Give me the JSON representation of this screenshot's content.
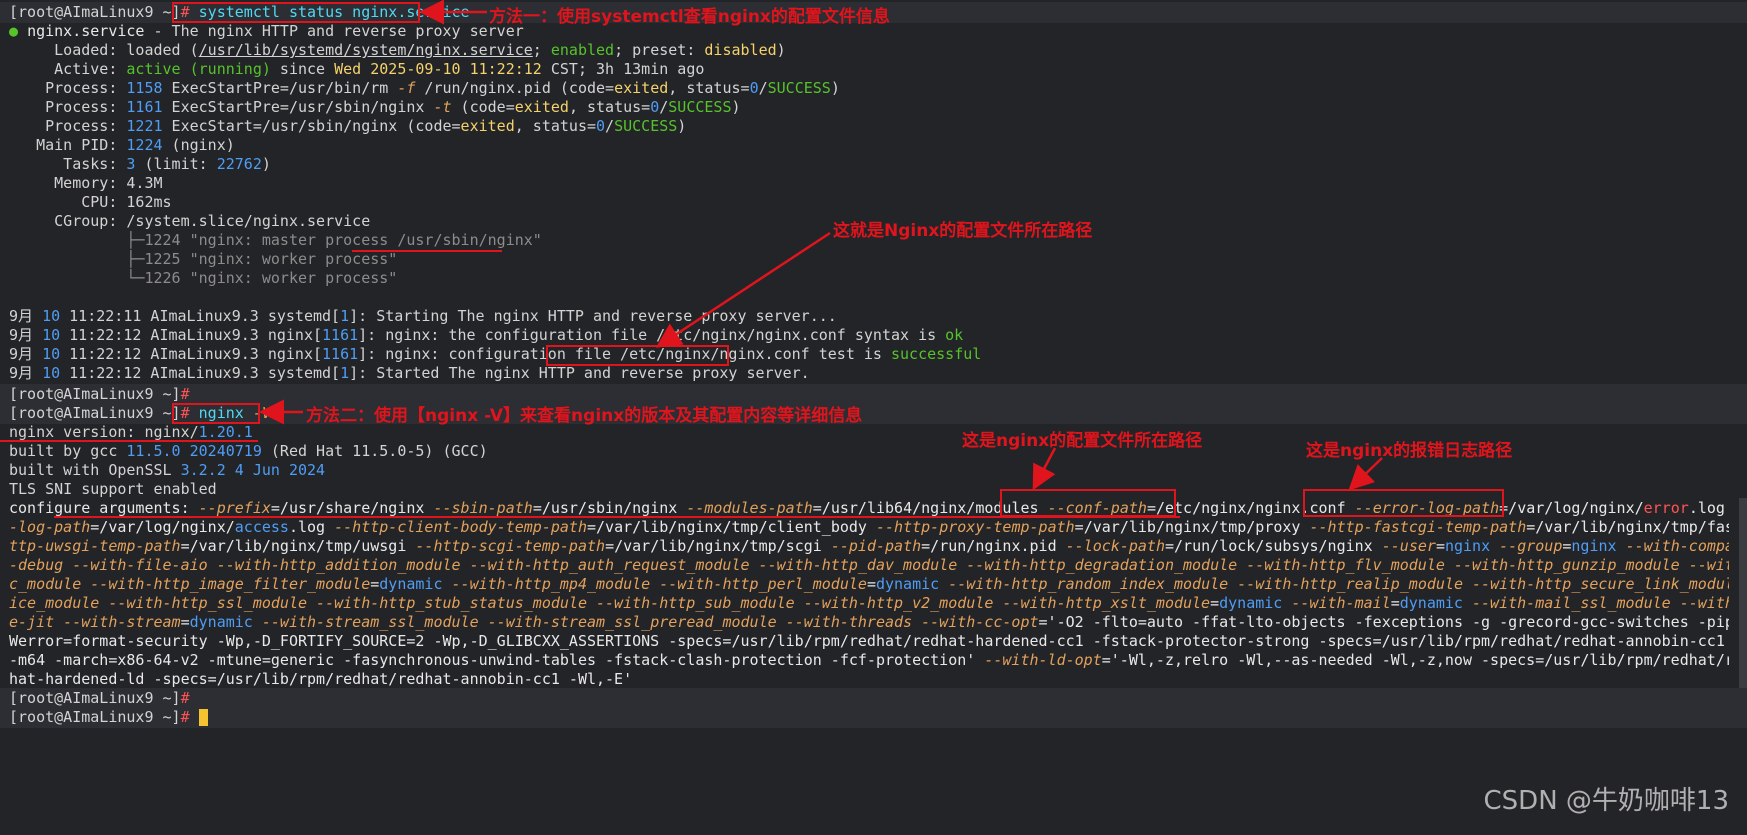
{
  "prompt": "[root@AImaLinux9 ~]",
  "cmd1": "systemctl status nginx.service",
  "status": {
    "line1_unit": "nginx.service",
    "line1_desc": " - The nginx HTTP and reverse proxy server",
    "loaded_label": "     Loaded: ",
    "loaded_text": "loaded (",
    "loaded_path": "/usr/lib/systemd/system/nginx.service",
    "loaded_rest_a": "; ",
    "loaded_enabled": "enabled",
    "loaded_rest_b": "; preset: ",
    "loaded_preset": "disabled",
    "loaded_close": ")",
    "active_label": "     Active: ",
    "active_val": "active (running)",
    "active_since": " since ",
    "active_date": "Wed 2025-09-10 11:22:12",
    "active_rest": " CST; 3h 13min ago",
    "proc1_label": "    Process: ",
    "proc1_pid": "1158",
    "proc1_cmd_a": " ExecStartPre=/usr/bin/rm ",
    "proc1_flag": "-f",
    "proc1_cmd_b": " /run/nginx.pid (code=",
    "proc1_code": "exited",
    "proc1_status": ", status=",
    "proc1_zero": "0",
    "proc1_slash": "/",
    "proc1_success": "SUCCESS",
    "proc1_close": ")",
    "proc2_label": "    Process: ",
    "proc2_pid": "1161",
    "proc2_cmd_a": " ExecStartPre=/usr/sbin/nginx ",
    "proc2_flag": "-t",
    "proc2_cmd_b": " (code=",
    "proc2_code": "exited",
    "proc2_status": ", status=",
    "proc2_zero": "0",
    "proc2_slash": "/",
    "proc2_success": "SUCCESS",
    "proc2_close": ")",
    "proc3_label": "    Process: ",
    "proc3_pid": "1221",
    "proc3_cmd_a": " ExecStart=/usr/sbin/nginx (code=",
    "proc3_code": "exited",
    "proc3_status": ", status=",
    "proc3_zero": "0",
    "proc3_slash": "/",
    "proc3_success": "SUCCESS",
    "proc3_close": ")",
    "mainpid_label": "   Main PID: ",
    "mainpid_val": "1224",
    "mainpid_rest": " (nginx)",
    "tasks_label": "      Tasks: ",
    "tasks_val": "3",
    "tasks_rest_a": " (limit: ",
    "tasks_limit": "22762",
    "tasks_close": ")",
    "memory_label": "     Memory: ",
    "memory_val": "4.3M",
    "cpu_label": "        CPU: ",
    "cpu_val": "162ms",
    "cgroup_label": "     CGroup: ",
    "cgroup_val": "/system.slice/nginx.service",
    "cg1": "             ├─1224 \"nginx: master process /usr/sbin/nginx\"",
    "cg2": "             ├─1225 \"nginx: worker process\"",
    "cg3": "             └─1226 \"nginx: worker process\""
  },
  "journal": {
    "j1_mon": "9月 ",
    "j1_day": "10",
    "j1_rest_a": " 11:22:11 AImaLinux9.3 systemd[",
    "j1_pid": "1",
    "j1_rest_b": "]: Starting The nginx HTTP and reverse proxy server...",
    "j2_mon": "9月 ",
    "j2_day": "10",
    "j2_rest_a": " 11:22:12 AImaLinux9.3 nginx[",
    "j2_pid": "1161",
    "j2_rest_b": "]: nginx: the configuration file /etc/nginx/nginx.conf syntax is ",
    "j2_ok": "ok",
    "j3_mon": "9月 ",
    "j3_day": "10",
    "j3_rest_a": " 11:22:12 AImaLinux9.3 nginx[",
    "j3_pid": "1161",
    "j3_rest_b": "]: nginx: configuration file /etc/nginx/nginx.conf test is ",
    "j3_ok": "successful",
    "j4_mon": "9月 ",
    "j4_day": "10",
    "j4_rest_a": " 11:22:12 AImaLinux9.3 systemd[",
    "j4_pid": "1",
    "j4_rest_b": "]: Started The nginx HTTP and reverse proxy server."
  },
  "cmd2_a": "nginx ",
  "cmd2_b": "-V",
  "nginxv": {
    "ver_label": "nginx version: nginx/",
    "ver_val": "1.20.1",
    "built_a": "built by gcc ",
    "built_b": "11.5.0 20240719",
    "built_c": " (Red Hat 11.5.0-5) (GCC)",
    "ssl_a": "built with OpenSSL ",
    "ssl_b": "3.2.2 4 Jun 2024",
    "tls": "TLS SNI support enabled"
  },
  "configure": {
    "c1": [
      [
        "wh",
        "configure arguments: "
      ],
      [
        "or",
        "--prefix"
      ],
      [
        "wh",
        "=/usr/share/nginx "
      ],
      [
        "or",
        "--sbin-path"
      ],
      [
        "wh",
        "=/usr/sbin/nginx "
      ],
      [
        "or",
        "--modules-path"
      ],
      [
        "wh",
        "=/usr/lib64/nginx/modules "
      ],
      [
        "or",
        "--conf-path"
      ],
      [
        "wh",
        "=/etc/nginx/nginx.conf "
      ],
      [
        "or",
        "--error-log-path"
      ],
      [
        "wh",
        "=/var/log/nginx/"
      ],
      [
        "rd",
        "error"
      ],
      [
        "wh",
        ".log "
      ],
      [
        "or",
        "--http"
      ]
    ],
    "c2": [
      [
        "or",
        "-log-path"
      ],
      [
        "wh",
        "=/var/log/nginx/"
      ],
      [
        "bl",
        "access"
      ],
      [
        "wh",
        ".log "
      ],
      [
        "or",
        "--http-client-body-temp-path"
      ],
      [
        "wh",
        "=/var/lib/nginx/tmp/client_body "
      ],
      [
        "or",
        "--http-proxy-temp-path"
      ],
      [
        "wh",
        "=/var/lib/nginx/tmp/proxy "
      ],
      [
        "or",
        "--http-fastcgi-temp-path"
      ],
      [
        "wh",
        "=/var/lib/nginx/tmp/fastcgi "
      ],
      [
        "or",
        "--h"
      ]
    ],
    "c3": [
      [
        "or",
        "ttp-uwsgi-temp-path"
      ],
      [
        "wh",
        "=/var/lib/nginx/tmp/uwsgi "
      ],
      [
        "or",
        "--http-scgi-temp-path"
      ],
      [
        "wh",
        "=/var/lib/nginx/tmp/scgi "
      ],
      [
        "or",
        "--pid-path"
      ],
      [
        "wh",
        "=/run/nginx.pid "
      ],
      [
        "or",
        "--lock-path"
      ],
      [
        "wh",
        "=/run/lock/subsys/nginx "
      ],
      [
        "or",
        "--user"
      ],
      [
        "wh",
        "="
      ],
      [
        "bl",
        "nginx"
      ],
      [
        "wh",
        " "
      ],
      [
        "or",
        "--group"
      ],
      [
        "wh",
        "="
      ],
      [
        "bl",
        "nginx"
      ],
      [
        "wh",
        " "
      ],
      [
        "or",
        "--with-compat --with"
      ]
    ],
    "c4": [
      [
        "or",
        "-debug --with-file-aio --with-http_addition_module --with-http_auth_request_module --with-http_dav_module --with-http_degradation_module --with-http_flv_module --with-http_gunzip_module --with-http_gzip_stati"
      ]
    ],
    "c5": [
      [
        "or",
        "c_module --with-http_image_filter_module"
      ],
      [
        "wh",
        "="
      ],
      [
        "bl",
        "dynamic"
      ],
      [
        "wh",
        " "
      ],
      [
        "or",
        "--with-http_mp4_module --with-http_perl_module"
      ],
      [
        "wh",
        "="
      ],
      [
        "bl",
        "dynamic"
      ],
      [
        "wh",
        " "
      ],
      [
        "or",
        "--with-http_random_index_module --with-http_realip_module --with-http_secure_link_module --with-http_sl"
      ]
    ],
    "c6": [
      [
        "or",
        "ice_module --with-http_ssl_module --with-http_stub_status_module --with-http_sub_module --with-http_v2_module --with-http_xslt_module"
      ],
      [
        "wh",
        "="
      ],
      [
        "bl",
        "dynamic"
      ],
      [
        "wh",
        " "
      ],
      [
        "or",
        "--with-mail"
      ],
      [
        "wh",
        "="
      ],
      [
        "bl",
        "dynamic"
      ],
      [
        "wh",
        " "
      ],
      [
        "or",
        "--with-mail_ssl_module --with-pcre --with-pcr"
      ]
    ],
    "c7": [
      [
        "or",
        "e-jit --with-stream"
      ],
      [
        "wh",
        "="
      ],
      [
        "bl",
        "dynamic"
      ],
      [
        "wh",
        " "
      ],
      [
        "or",
        "--with-stream_ssl_module --with-stream_ssl_preread_module --with-threads --with-cc-opt"
      ],
      [
        "wh",
        "='-O2 -flto=auto -ffat-lto-objects -fexceptions -g -grecord-gcc-switches -pipe -Wall -"
      ]
    ],
    "c8": [
      [
        "wh",
        "Werror=format-security -Wp,-D_FORTIFY_SOURCE=2 -Wp,-D_GLIBCXX_ASSERTIONS -specs=/usr/lib/rpm/redhat/redhat-hardened-cc1 -fstack-protector-strong -specs=/usr/lib/rpm/redhat/redhat-annobin-cc1 "
      ]
    ],
    "c9": [
      [
        "wh",
        "-m64 -march=x86-64-v2 -mtune=generic -fasynchronous-unwind-tables -fstack-clash-protection -fcf-protection' "
      ],
      [
        "or",
        "--with-ld-opt"
      ],
      [
        "wh",
        "='-Wl,-z,relro -Wl,--as-needed -Wl,-z,now -specs=/usr/lib/rpm/redhat/red"
      ]
    ],
    "c10": [
      [
        "wh",
        "hat-hardened-ld -specs=/usr/lib/rpm/redhat/redhat-annobin-cc1 -Wl,-E'"
      ]
    ]
  },
  "annotations": {
    "a1": "方法一：使用systemctl查看nginx的配置文件信息",
    "a2": "这就是Nginx的配置文件所在路径",
    "a3": "方法二：使用【nginx -V】来查看nginx的版本及其配置内容等详细信息",
    "a4": "这是nginx的配置文件所在路径",
    "a5": "这是nginx的报错日志路径"
  },
  "watermark": "CSDN @牛奶咖啡13",
  "colors": {
    "background": "#232427",
    "annotation_red": "#e0141c",
    "green": "#56c32b",
    "blue": "#4f9df5",
    "orange_flag": "#e2a15c",
    "command_cyan": "#4fd9f5"
  }
}
